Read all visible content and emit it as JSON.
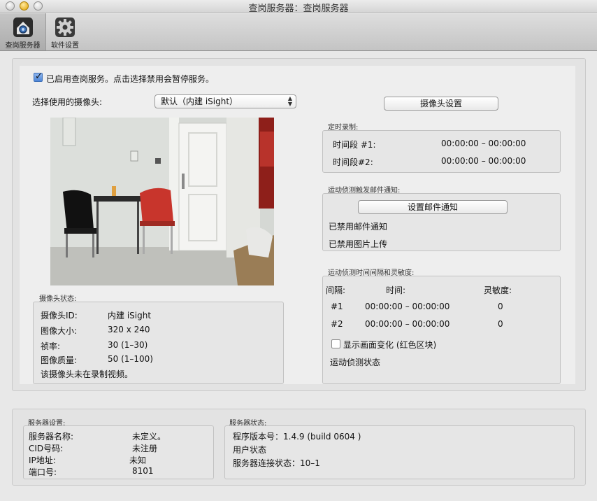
{
  "window": {
    "title": "查岗服务器：查岗服务器"
  },
  "toolbar": {
    "items": [
      {
        "label": "查岗服务器",
        "icon": "home-camera-icon",
        "selected": true
      },
      {
        "label": "软件设置",
        "icon": "gear-icon",
        "selected": false
      }
    ]
  },
  "service": {
    "enabled": true,
    "enable_label": "已启用查岗服务。点击选择禁用会暂停服务。"
  },
  "camera_select": {
    "label": "选择使用的摄像头:",
    "value": "默认（内建 iSight）"
  },
  "camera_settings_button": "摄像头设置",
  "schedule": {
    "title": "定时录制:",
    "rows": [
      {
        "label": "时间段 #1:",
        "value": "00:00:00 – 00:00:00"
      },
      {
        "label": "时间段#2:",
        "value": "00:00:00 – 00:00:00"
      }
    ]
  },
  "email": {
    "title": "运动侦测触发邮件通知:",
    "button": "设置邮件通知",
    "status1": "已禁用邮件通知",
    "status2": "已禁用图片上传"
  },
  "motion": {
    "title": "运动侦测时间间隔和灵敏度:",
    "headers": {
      "interval": "间隔:",
      "time": "时间:",
      "sensitivity": "灵敏度:"
    },
    "rows": [
      {
        "id": "#1",
        "time": "00:00:00 – 00:00:00",
        "sensitivity": "0"
      },
      {
        "id": "#2",
        "time": "00:00:00 – 00:00:00",
        "sensitivity": "0"
      }
    ],
    "show_changes": {
      "checked": false,
      "label": "显示画面变化 (红色区块)"
    },
    "status": "运动侦测状态"
  },
  "camera_status": {
    "title": "摄像头状态:",
    "rows": [
      {
        "label": "摄像头ID:",
        "value": "内建 iSight"
      },
      {
        "label": "图像大小:",
        "value": "320 x 240"
      },
      {
        "label": "祯率:",
        "value": "30 (1–30)"
      },
      {
        "label": "图像质量:",
        "value": "50 (1–100)"
      }
    ],
    "note": "该摄像头未在录制视频。"
  },
  "server_settings": {
    "title": "服务器设置:",
    "rows": [
      {
        "label": "服务器名称:",
        "value": "未定义。"
      },
      {
        "label": "CID号码:",
        "value": "未注册"
      },
      {
        "label": "IP地址:",
        "value": "未知"
      },
      {
        "label": "端口号:",
        "value": "8101"
      }
    ]
  },
  "server_status": {
    "title": "服务器状态:",
    "version": "程序版本号：1.4.9 (build 0604 )",
    "user_status": "用户状态",
    "connection": "服务器连接状态：10–1"
  },
  "colors": {
    "checkbox_accent": "#4d86d8",
    "wall": "#d9dcd8",
    "chair_red": "#c0392b"
  }
}
